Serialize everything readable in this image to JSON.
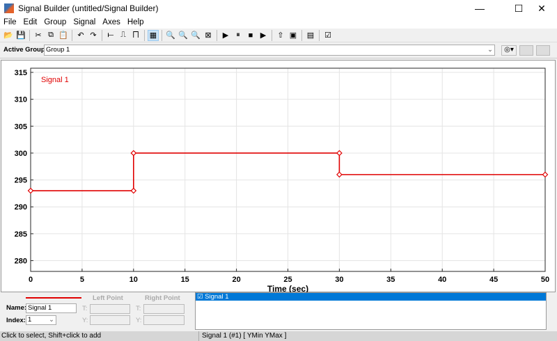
{
  "window": {
    "title": "Signal Builder (untitled/Signal Builder)",
    "minimize": "—",
    "maximize": "☐",
    "close": "✕"
  },
  "menu": [
    "File",
    "Edit",
    "Group",
    "Signal",
    "Axes",
    "Help"
  ],
  "toolbar": [
    {
      "name": "open-icon",
      "glyph": "📂"
    },
    {
      "name": "save-icon",
      "glyph": "💾"
    },
    {
      "sep": true
    },
    {
      "name": "cut-icon",
      "glyph": "✂"
    },
    {
      "name": "copy-icon",
      "glyph": "⧉"
    },
    {
      "name": "paste-icon",
      "glyph": "📋"
    },
    {
      "sep": true
    },
    {
      "name": "undo-icon",
      "glyph": "↶"
    },
    {
      "name": "redo-icon",
      "glyph": "↷"
    },
    {
      "sep": true
    },
    {
      "name": "constant-icon",
      "glyph": "⟝"
    },
    {
      "name": "step-icon",
      "glyph": "⎍"
    },
    {
      "name": "pulse-icon",
      "glyph": "⨅"
    },
    {
      "sep": true
    },
    {
      "name": "grid-icon",
      "glyph": "▦"
    },
    {
      "sep": true
    },
    {
      "name": "zoom-x-icon",
      "glyph": "🔍"
    },
    {
      "name": "zoom-y-icon",
      "glyph": "🔍"
    },
    {
      "name": "zoom-xy-icon",
      "glyph": "🔍"
    },
    {
      "name": "fit-icon",
      "glyph": "⊠"
    },
    {
      "sep": true
    },
    {
      "name": "play-icon",
      "glyph": "▶"
    },
    {
      "name": "pause-icon",
      "glyph": "⏸"
    },
    {
      "name": "stop-icon",
      "glyph": "■"
    },
    {
      "name": "run-all-icon",
      "glyph": "▶"
    },
    {
      "sep": true
    },
    {
      "name": "up-arrow-icon",
      "glyph": "⇧"
    },
    {
      "name": "block-icon",
      "glyph": "▣"
    },
    {
      "sep": true
    },
    {
      "name": "scope-icon",
      "glyph": "▤"
    },
    {
      "sep": true
    },
    {
      "name": "verify-icon",
      "glyph": "☑"
    }
  ],
  "active_group": {
    "label": "Active Group:",
    "value": "Group 1"
  },
  "chart_data": {
    "type": "line",
    "title": "",
    "xlabel": "Time (sec)",
    "ylabel": "",
    "xlim": [
      0,
      50
    ],
    "ylim": [
      278,
      315
    ],
    "xticks": [
      0,
      5,
      10,
      15,
      20,
      25,
      30,
      35,
      40,
      45,
      50
    ],
    "yticks": [
      280,
      285,
      290,
      295,
      300,
      305,
      310,
      315
    ],
    "grid": true,
    "legend": "top-left",
    "series": [
      {
        "name": "Signal 1",
        "color": "#e00000",
        "x": [
          0,
          10,
          10,
          30,
          30,
          50
        ],
        "y": [
          293,
          293,
          300,
          300,
          296,
          296
        ]
      }
    ]
  },
  "signal_panel": {
    "name_label": "Name:",
    "name_value": "Signal 1",
    "index_label": "Index:",
    "index_value": "1",
    "left_point": "Left Point",
    "right_point": "Right Point",
    "t_label": "T:",
    "y_label": "Y:"
  },
  "signal_list": [
    "☑ Signal 1"
  ],
  "status": {
    "left": "Click to select, Shift+click to add",
    "right": "Signal 1 (#1)  [ YMin YMax ]"
  }
}
